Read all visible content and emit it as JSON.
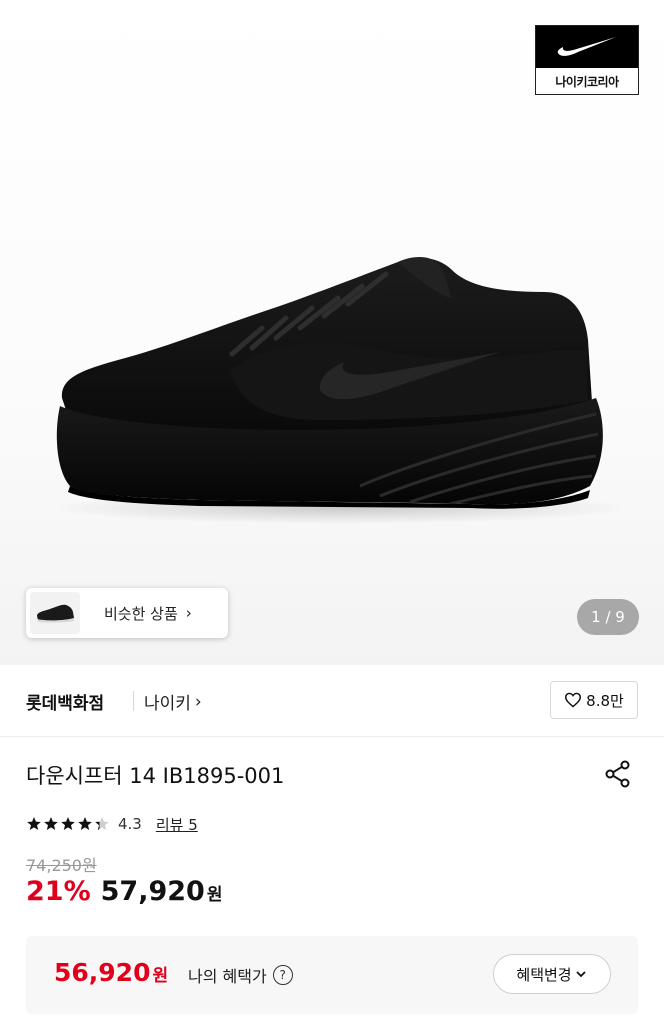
{
  "hero": {
    "brand_logo_text": "나이키코리아",
    "similar_label": "비슷한 상품",
    "similar_chevron": "›",
    "page_indicator": "1 / 9"
  },
  "store": {
    "name": "롯데백화점",
    "brand": "나이키",
    "brand_chevron": "›",
    "likes": "8.8만"
  },
  "product": {
    "title": "다운시프터 14 IB1895-001",
    "rating": "4.3",
    "rating_value": 4.3,
    "review_label": "리뷰 5",
    "original_price": "74,250원",
    "discount": "21%",
    "price": "57,920",
    "currency": "원"
  },
  "benefit": {
    "price": "56,920",
    "currency": "원",
    "label": "나의 혜택가",
    "help": "?",
    "change_label": "혜택변경"
  },
  "colors": {
    "accent_red": "#e0001b",
    "text": "#111111",
    "muted": "#999999"
  }
}
